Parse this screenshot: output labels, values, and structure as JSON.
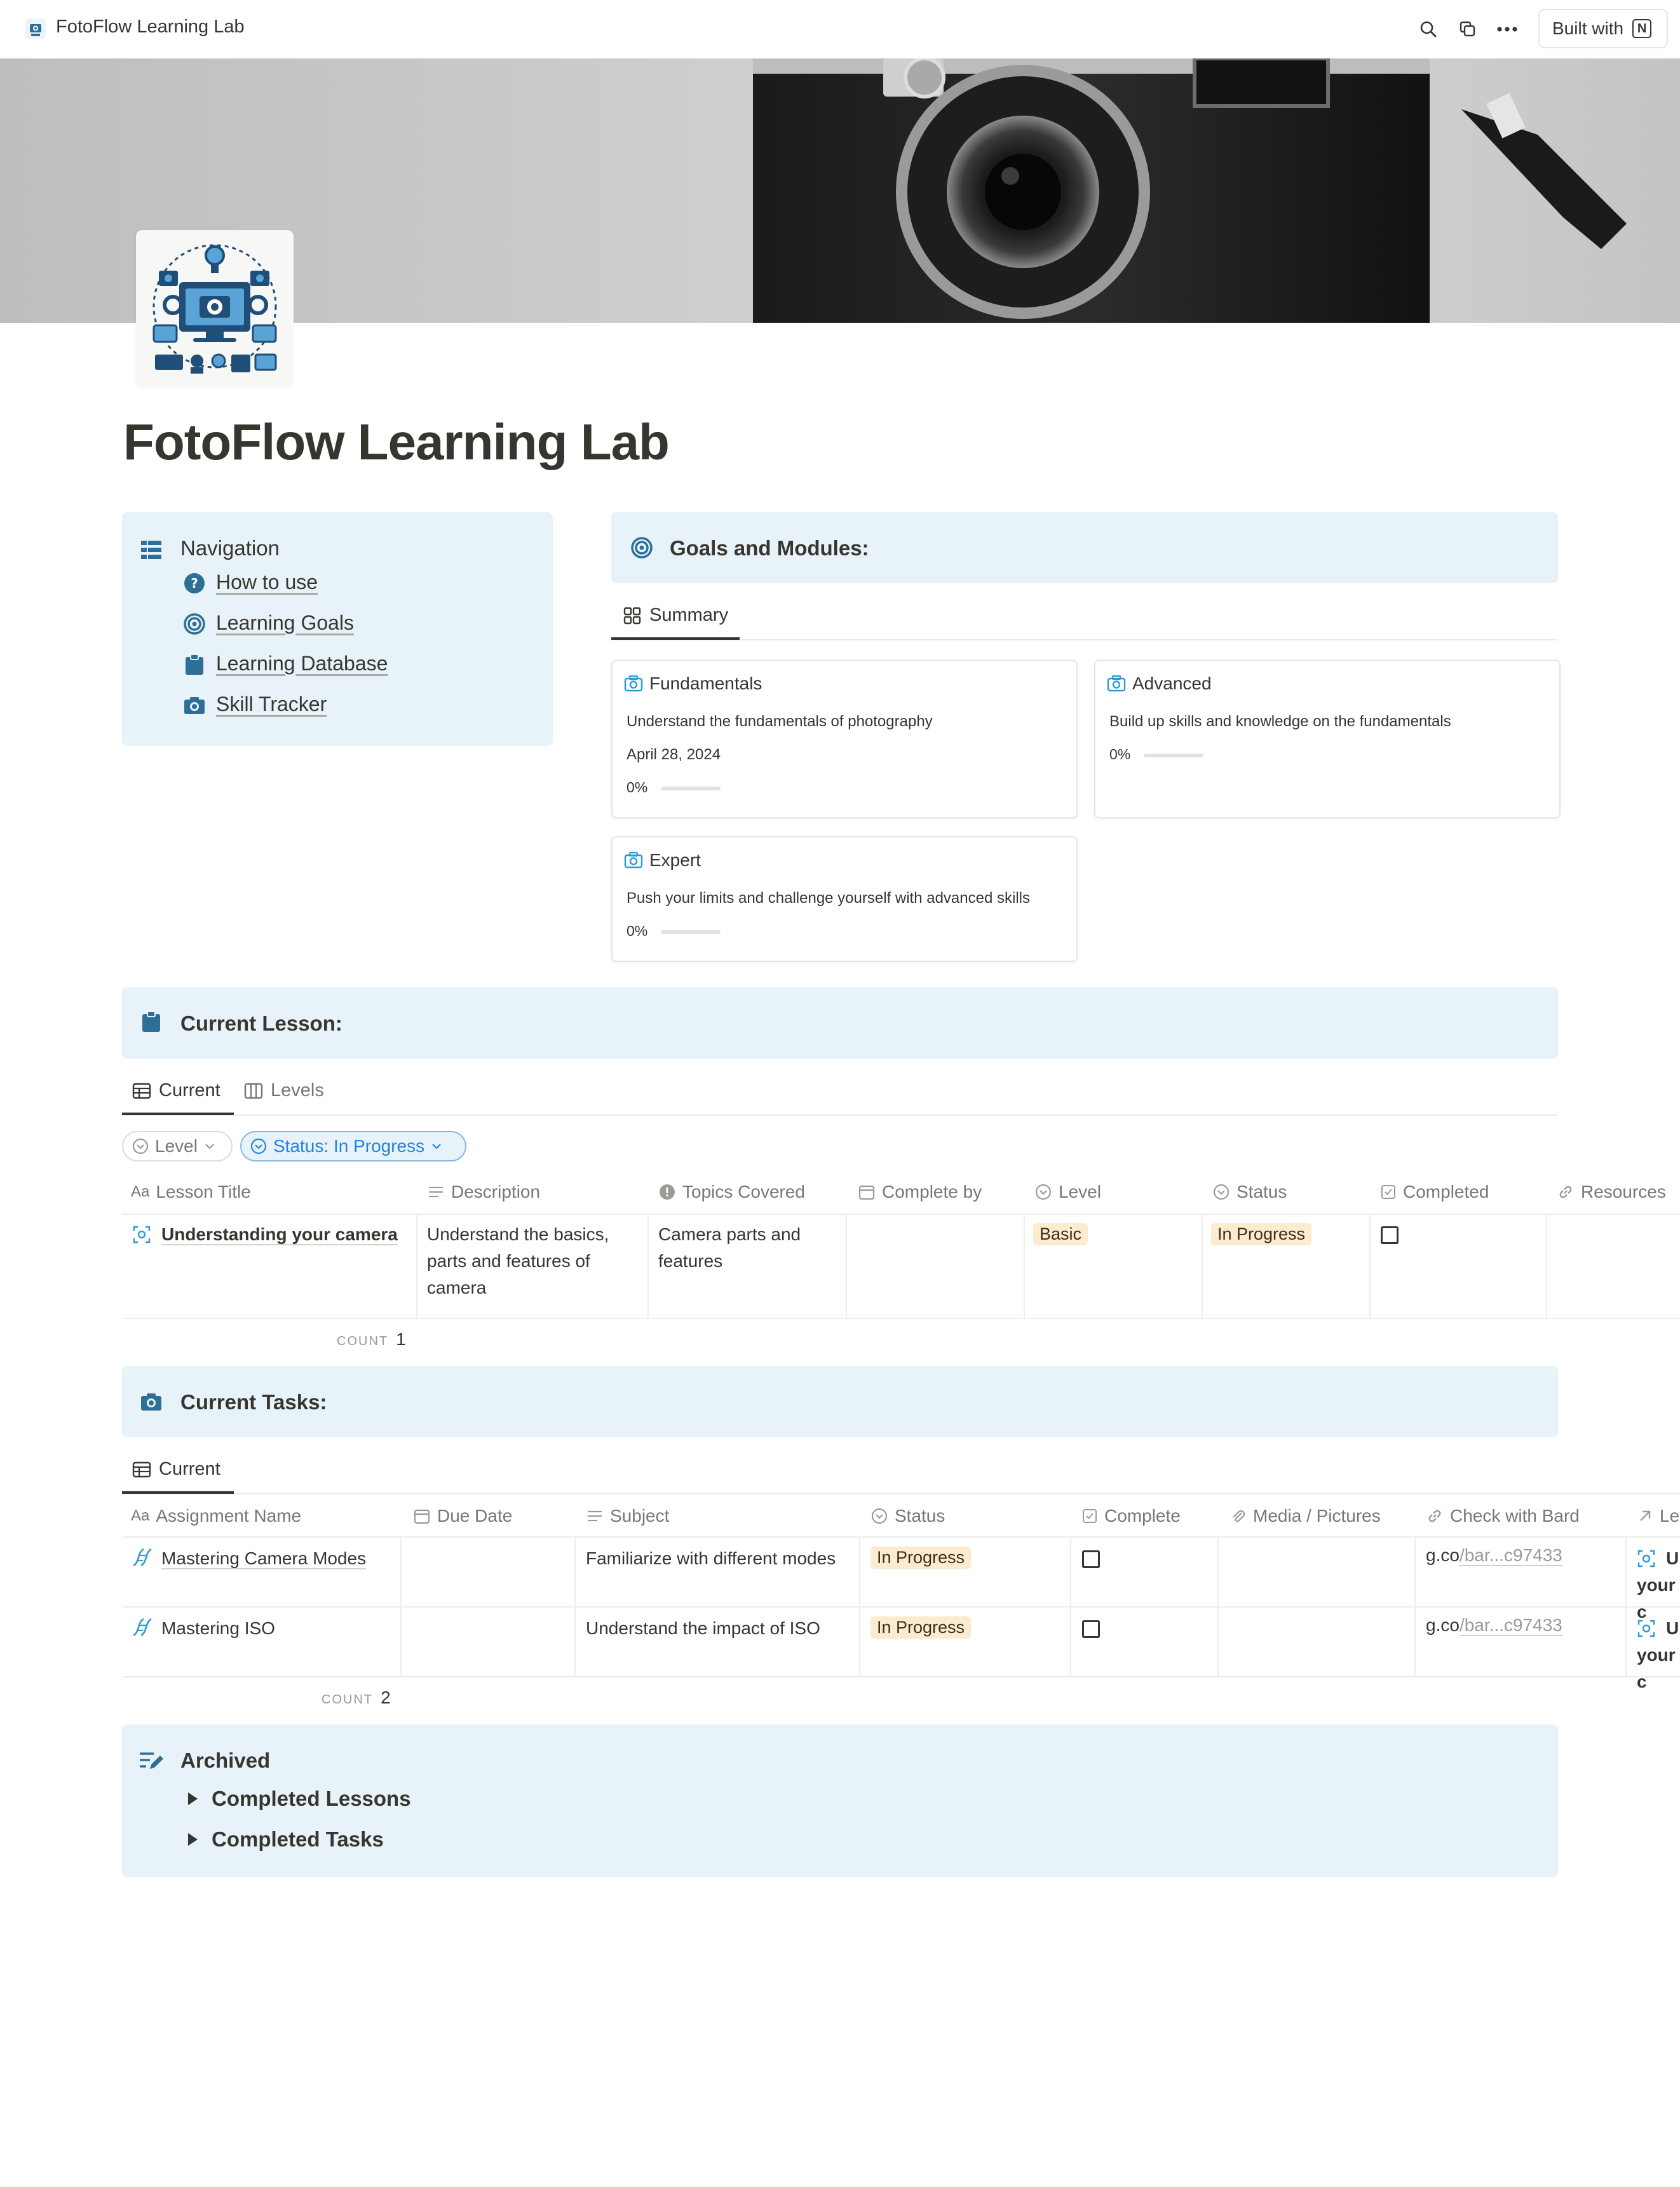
{
  "topbar": {
    "app_title": "FotoFlow Learning Lab",
    "built_with_label": "Built with",
    "notion_logo_letter": "N",
    "icons": [
      "app-logo-icon",
      "search-icon",
      "duplicate-icon",
      "more-icon"
    ]
  },
  "page": {
    "title": "FotoFlow Learning Lab",
    "cover": "camera-cover-image",
    "accent_color": "#2e6f97",
    "callout_bg": "#e7f3f8"
  },
  "navigation": {
    "title": "Navigation",
    "items": [
      {
        "label": "How to use",
        "icon": "question-icon"
      },
      {
        "label": "Learning Goals",
        "icon": "target-icon"
      },
      {
        "label": "Learning Database",
        "icon": "clipboard-icon"
      },
      {
        "label": "Skill Tracker",
        "icon": "camera-icon"
      }
    ]
  },
  "goals": {
    "title": "Goals and Modules:",
    "tab": "Summary",
    "cards": [
      {
        "title": "Fundamentals",
        "description": "Understand the fundamentals of photography",
        "date": "April 28, 2024",
        "progress_label": "0%",
        "progress": 0
      },
      {
        "title": "Advanced",
        "description": "Build up skills and knowledge on the fundamentals",
        "progress_label": "0%",
        "progress": 0
      },
      {
        "title": "Expert",
        "description": "Push your limits and challenge yourself with advanced skills",
        "progress_label": "0%",
        "progress": 0
      }
    ]
  },
  "current_lesson": {
    "title": "Current Lesson:",
    "tabs": [
      "Current",
      "Levels"
    ],
    "filters": [
      {
        "label": "Level"
      },
      {
        "label": "Status: In Progress"
      }
    ],
    "columns": [
      "Lesson Title",
      "Description",
      "Topics Covered",
      "Complete by",
      "Level",
      "Status",
      "Completed",
      "Resources"
    ],
    "column_prefix": "Aa",
    "rows": [
      {
        "title": "Understanding your camera",
        "description": [
          "Understand the basics,",
          "parts and features of",
          "camera"
        ],
        "topics": [
          "Camera parts and",
          "features"
        ],
        "complete_by": "",
        "level": "Basic",
        "status": "In Progress",
        "completed": false
      }
    ],
    "count_label": "COUNT",
    "count_value": "1"
  },
  "current_tasks": {
    "title": "Current Tasks:",
    "tab": "Current",
    "columns": [
      "Assignment Name",
      "Due Date",
      "Subject",
      "Status",
      "Complete",
      "Media / Pictures",
      "Check with Bard",
      "Le"
    ],
    "column_prefix": "Aa",
    "rows": [
      {
        "name": "Mastering Camera Modes",
        "due": "",
        "subject": "Familiarize with different modes",
        "status": "In Progress",
        "complete": false,
        "link_host": "g.co",
        "link_path": "/bar...c97433",
        "lesson_line1": "U",
        "lesson_line2": "your c"
      },
      {
        "name": "Mastering ISO",
        "due": "",
        "subject": "Understand the impact of ISO",
        "status": "In Progress",
        "complete": false,
        "link_host": "g.co",
        "link_path": "/bar...c97433",
        "lesson_line1": "U",
        "lesson_line2": "your c"
      }
    ],
    "count_label": "COUNT",
    "count_value": "2"
  },
  "archived": {
    "title": "Archived",
    "toggles": [
      "Completed Lessons",
      "Completed Tasks"
    ]
  }
}
